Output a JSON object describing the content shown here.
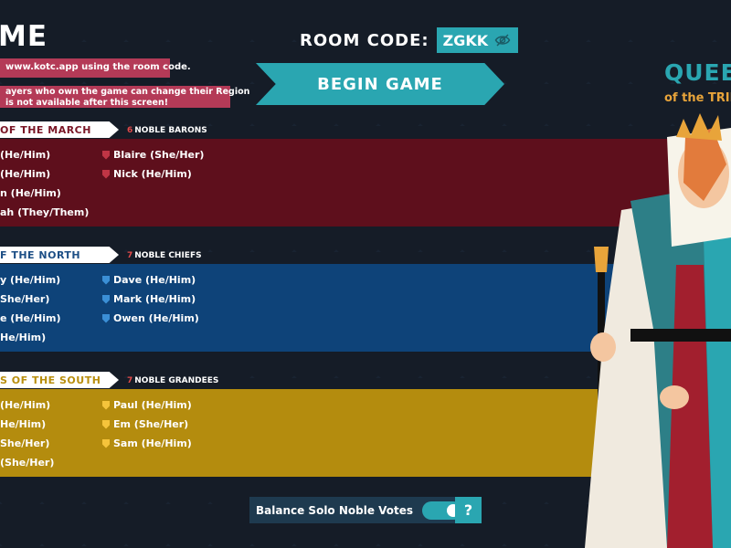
{
  "header": {
    "title": "ME",
    "info_1": "www.kotc.app using the room code.",
    "info_2_line1": "ayers who own the game can change their Region",
    "info_2_line2": "is not available after this screen!"
  },
  "room": {
    "label": "ROOM CODE:",
    "code": "ZGKK",
    "icon": "eye-hidden-icon"
  },
  "begin_label": "BEGIN GAME",
  "queen": {
    "title": "QUEE",
    "subtitle": "of the TRIB"
  },
  "kingdoms": [
    {
      "name": "OF THE MARCH",
      "noble_count": "6",
      "noble_label": "NOBLE BARONS",
      "color": "#5e0f1c",
      "players_col1": [
        "(He/Him)",
        "(He/Him)",
        "n (He/Him)",
        "ah (They/Them)"
      ],
      "players_col2": [
        "Blaire (She/Her)",
        "Nick (He/Him)"
      ]
    },
    {
      "name": "F THE NORTH",
      "noble_count": "7",
      "noble_label": "NOBLE CHIEFS",
      "color": "#0e4379",
      "players_col1": [
        "y (He/Him)",
        "She/Her)",
        "e (He/Him)",
        "He/Him)"
      ],
      "players_col2": [
        "Dave (He/Him)",
        "Mark (He/Him)",
        "Owen (He/Him)"
      ]
    },
    {
      "name": "S OF THE SOUTH",
      "noble_count": "7",
      "noble_label": "NOBLE GRANDEES",
      "color": "#b48c0e",
      "players_col1": [
        "(He/Him)",
        "He/Him)",
        "She/Her)",
        "(She/Her)"
      ],
      "players_col2": [
        "Paul (He/Him)",
        "Em (She/Her)",
        "Sam (He/Him)"
      ]
    }
  ],
  "balance": {
    "label": "Balance Solo Noble Votes",
    "enabled": true
  },
  "help_label": "?"
}
